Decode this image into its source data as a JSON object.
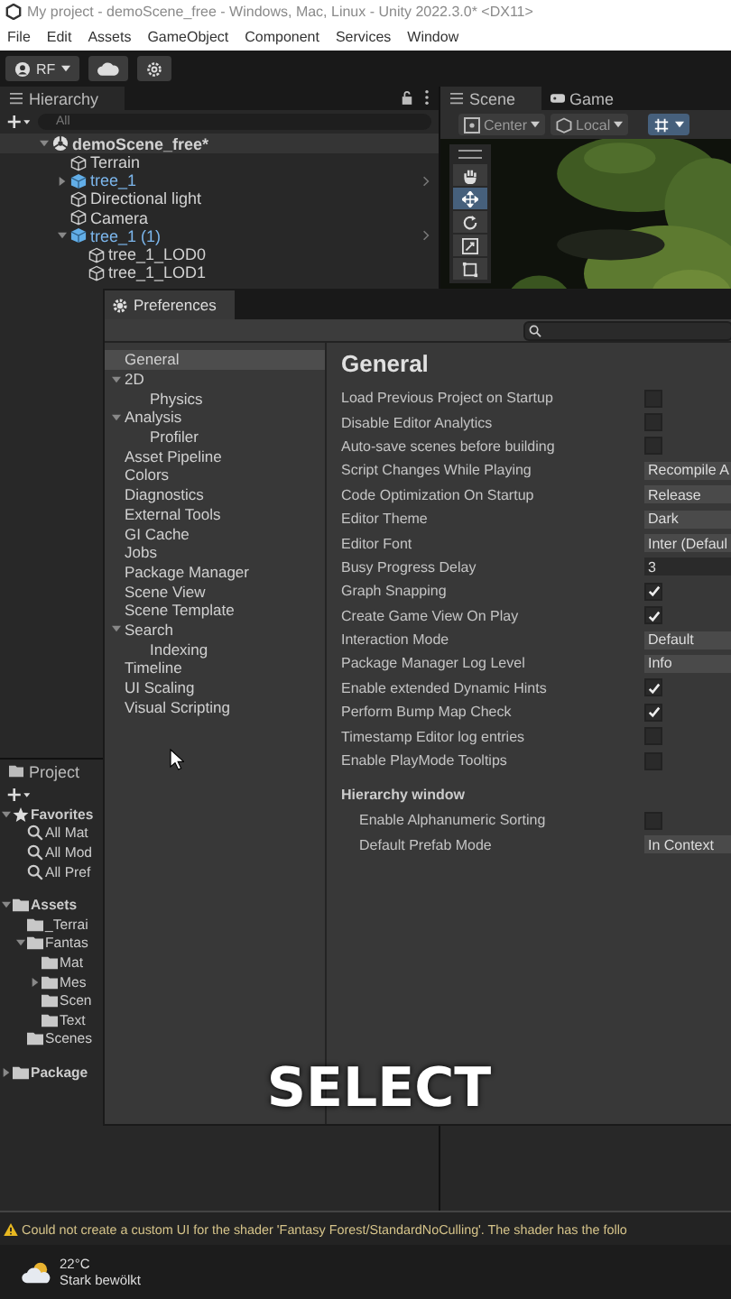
{
  "window": {
    "title": "My project - demoScene_free - Windows, Mac, Linux - Unity 2022.3.0* <DX11>"
  },
  "menu": [
    "File",
    "Edit",
    "Assets",
    "GameObject",
    "Component",
    "Services",
    "Window"
  ],
  "toolbar": {
    "account": "RF"
  },
  "hierarchy": {
    "tab": "Hierarchy",
    "search": {
      "placeholder": "All"
    },
    "items": [
      {
        "label": "demoScene_free*",
        "kind": "scene",
        "expanded": true,
        "children": [
          {
            "label": "Terrain",
            "kind": "object"
          },
          {
            "label": "tree_1",
            "kind": "prefab",
            "expanded": false
          },
          {
            "label": "Directional light",
            "kind": "object"
          },
          {
            "label": "Camera",
            "kind": "object"
          },
          {
            "label": "tree_1 (1)",
            "kind": "prefab",
            "expanded": true,
            "children": [
              {
                "label": "tree_1_LOD0",
                "kind": "object"
              },
              {
                "label": "tree_1_LOD1",
                "kind": "object"
              }
            ]
          }
        ]
      }
    ]
  },
  "project": {
    "tab": "Project",
    "items": [
      {
        "label": "Favorites",
        "kind": "favorite",
        "expanded": true,
        "children": [
          {
            "label": "All Mat",
            "kind": "search"
          },
          {
            "label": "All Mod",
            "kind": "search"
          },
          {
            "label": "All Pref",
            "kind": "search"
          }
        ]
      },
      {
        "label": "Assets",
        "kind": "folder",
        "expanded": true,
        "children": [
          {
            "label": "_Terrai",
            "kind": "folder"
          },
          {
            "label": "Fantas",
            "kind": "folder",
            "expanded": true,
            "children": [
              {
                "label": "Mat",
                "kind": "folder"
              },
              {
                "label": "Mes",
                "kind": "folder",
                "expanded": false
              },
              {
                "label": "Scen",
                "kind": "folder"
              },
              {
                "label": "Text",
                "kind": "folder"
              }
            ]
          },
          {
            "label": "Scenes",
            "kind": "folder"
          }
        ]
      },
      {
        "label": "Package",
        "kind": "folder",
        "expanded": false
      }
    ]
  },
  "scene": {
    "tabs": [
      {
        "label": "Scene",
        "selected": true
      },
      {
        "label": "Game",
        "selected": false
      }
    ],
    "pivot": "Center",
    "space": "Local",
    "tools": [
      {
        "kind": "hand",
        "selected": false
      },
      {
        "kind": "move",
        "selected": true
      },
      {
        "kind": "rotate",
        "selected": false
      },
      {
        "kind": "scale",
        "selected": false
      },
      {
        "kind": "rect",
        "selected": false
      }
    ]
  },
  "preferences": {
    "title": "Preferences",
    "nav": [
      {
        "label": "General",
        "selected": true
      },
      {
        "label": "2D",
        "selected": false,
        "expanded": true,
        "children": [
          {
            "label": "Physics",
            "selected": false
          }
        ]
      },
      {
        "label": "Analysis",
        "selected": false,
        "expanded": true,
        "children": [
          {
            "label": "Profiler",
            "selected": false
          }
        ]
      },
      {
        "label": "Asset Pipeline",
        "selected": false
      },
      {
        "label": "Colors",
        "selected": false
      },
      {
        "label": "Diagnostics",
        "selected": false
      },
      {
        "label": "External Tools",
        "selected": false
      },
      {
        "label": "GI Cache",
        "selected": false
      },
      {
        "label": "Jobs",
        "selected": false
      },
      {
        "label": "Package Manager",
        "selected": false
      },
      {
        "label": "Scene View",
        "selected": false
      },
      {
        "label": "Scene Template",
        "selected": false
      },
      {
        "label": "Search",
        "selected": false,
        "expanded": true,
        "children": [
          {
            "label": "Indexing",
            "selected": false
          }
        ]
      },
      {
        "label": "Timeline",
        "selected": false
      },
      {
        "label": "UI Scaling",
        "selected": false
      },
      {
        "label": "Visual Scripting",
        "selected": false
      }
    ],
    "heading": "General",
    "settings": [
      {
        "label": "Load Previous Project on Startup",
        "kind": "checkbox",
        "checked": false
      },
      {
        "label": "Disable Editor Analytics",
        "kind": "checkbox",
        "checked": false
      },
      {
        "label": "Auto-save scenes before building",
        "kind": "checkbox",
        "checked": false
      },
      {
        "label": "Script Changes While Playing",
        "kind": "dropdown",
        "value": "Recompile A"
      },
      {
        "label": "Code Optimization On Startup",
        "kind": "dropdown",
        "value": "Release"
      },
      {
        "label": "Editor Theme",
        "kind": "dropdown",
        "value": "Dark"
      },
      {
        "label": "Editor Font",
        "kind": "dropdown",
        "value": "Inter (Defaul"
      },
      {
        "label": "Busy Progress Delay",
        "kind": "number",
        "value": "3"
      },
      {
        "label": "Graph Snapping",
        "kind": "checkbox",
        "checked": true
      },
      {
        "label": "Create Game View On Play",
        "kind": "checkbox",
        "checked": true
      },
      {
        "label": "Interaction Mode",
        "kind": "dropdown",
        "value": "Default"
      },
      {
        "label": "Package Manager Log Level",
        "kind": "dropdown",
        "value": "Info"
      },
      {
        "label": "Enable extended Dynamic Hints",
        "kind": "checkbox",
        "checked": true
      },
      {
        "label": "Perform Bump Map Check",
        "kind": "checkbox",
        "checked": true
      },
      {
        "label": "Timestamp Editor log entries",
        "kind": "checkbox",
        "checked": false
      },
      {
        "label": "Enable PlayMode Tooltips",
        "kind": "checkbox",
        "checked": false
      }
    ],
    "section": {
      "title": "Hierarchy window",
      "settings": [
        {
          "label": "Enable Alphanumeric Sorting",
          "kind": "checkbox",
          "checked": false
        },
        {
          "label": "Default Prefab Mode",
          "kind": "dropdown",
          "value": "In Context"
        }
      ]
    }
  },
  "caption": "SELECT",
  "console": {
    "message": "Could not create a custom UI for the shader 'Fantasy Forest/StandardNoCulling'. The shader has the follo"
  },
  "taskbar": {
    "temperature": "22°C",
    "weather": "Stark bewölkt"
  }
}
